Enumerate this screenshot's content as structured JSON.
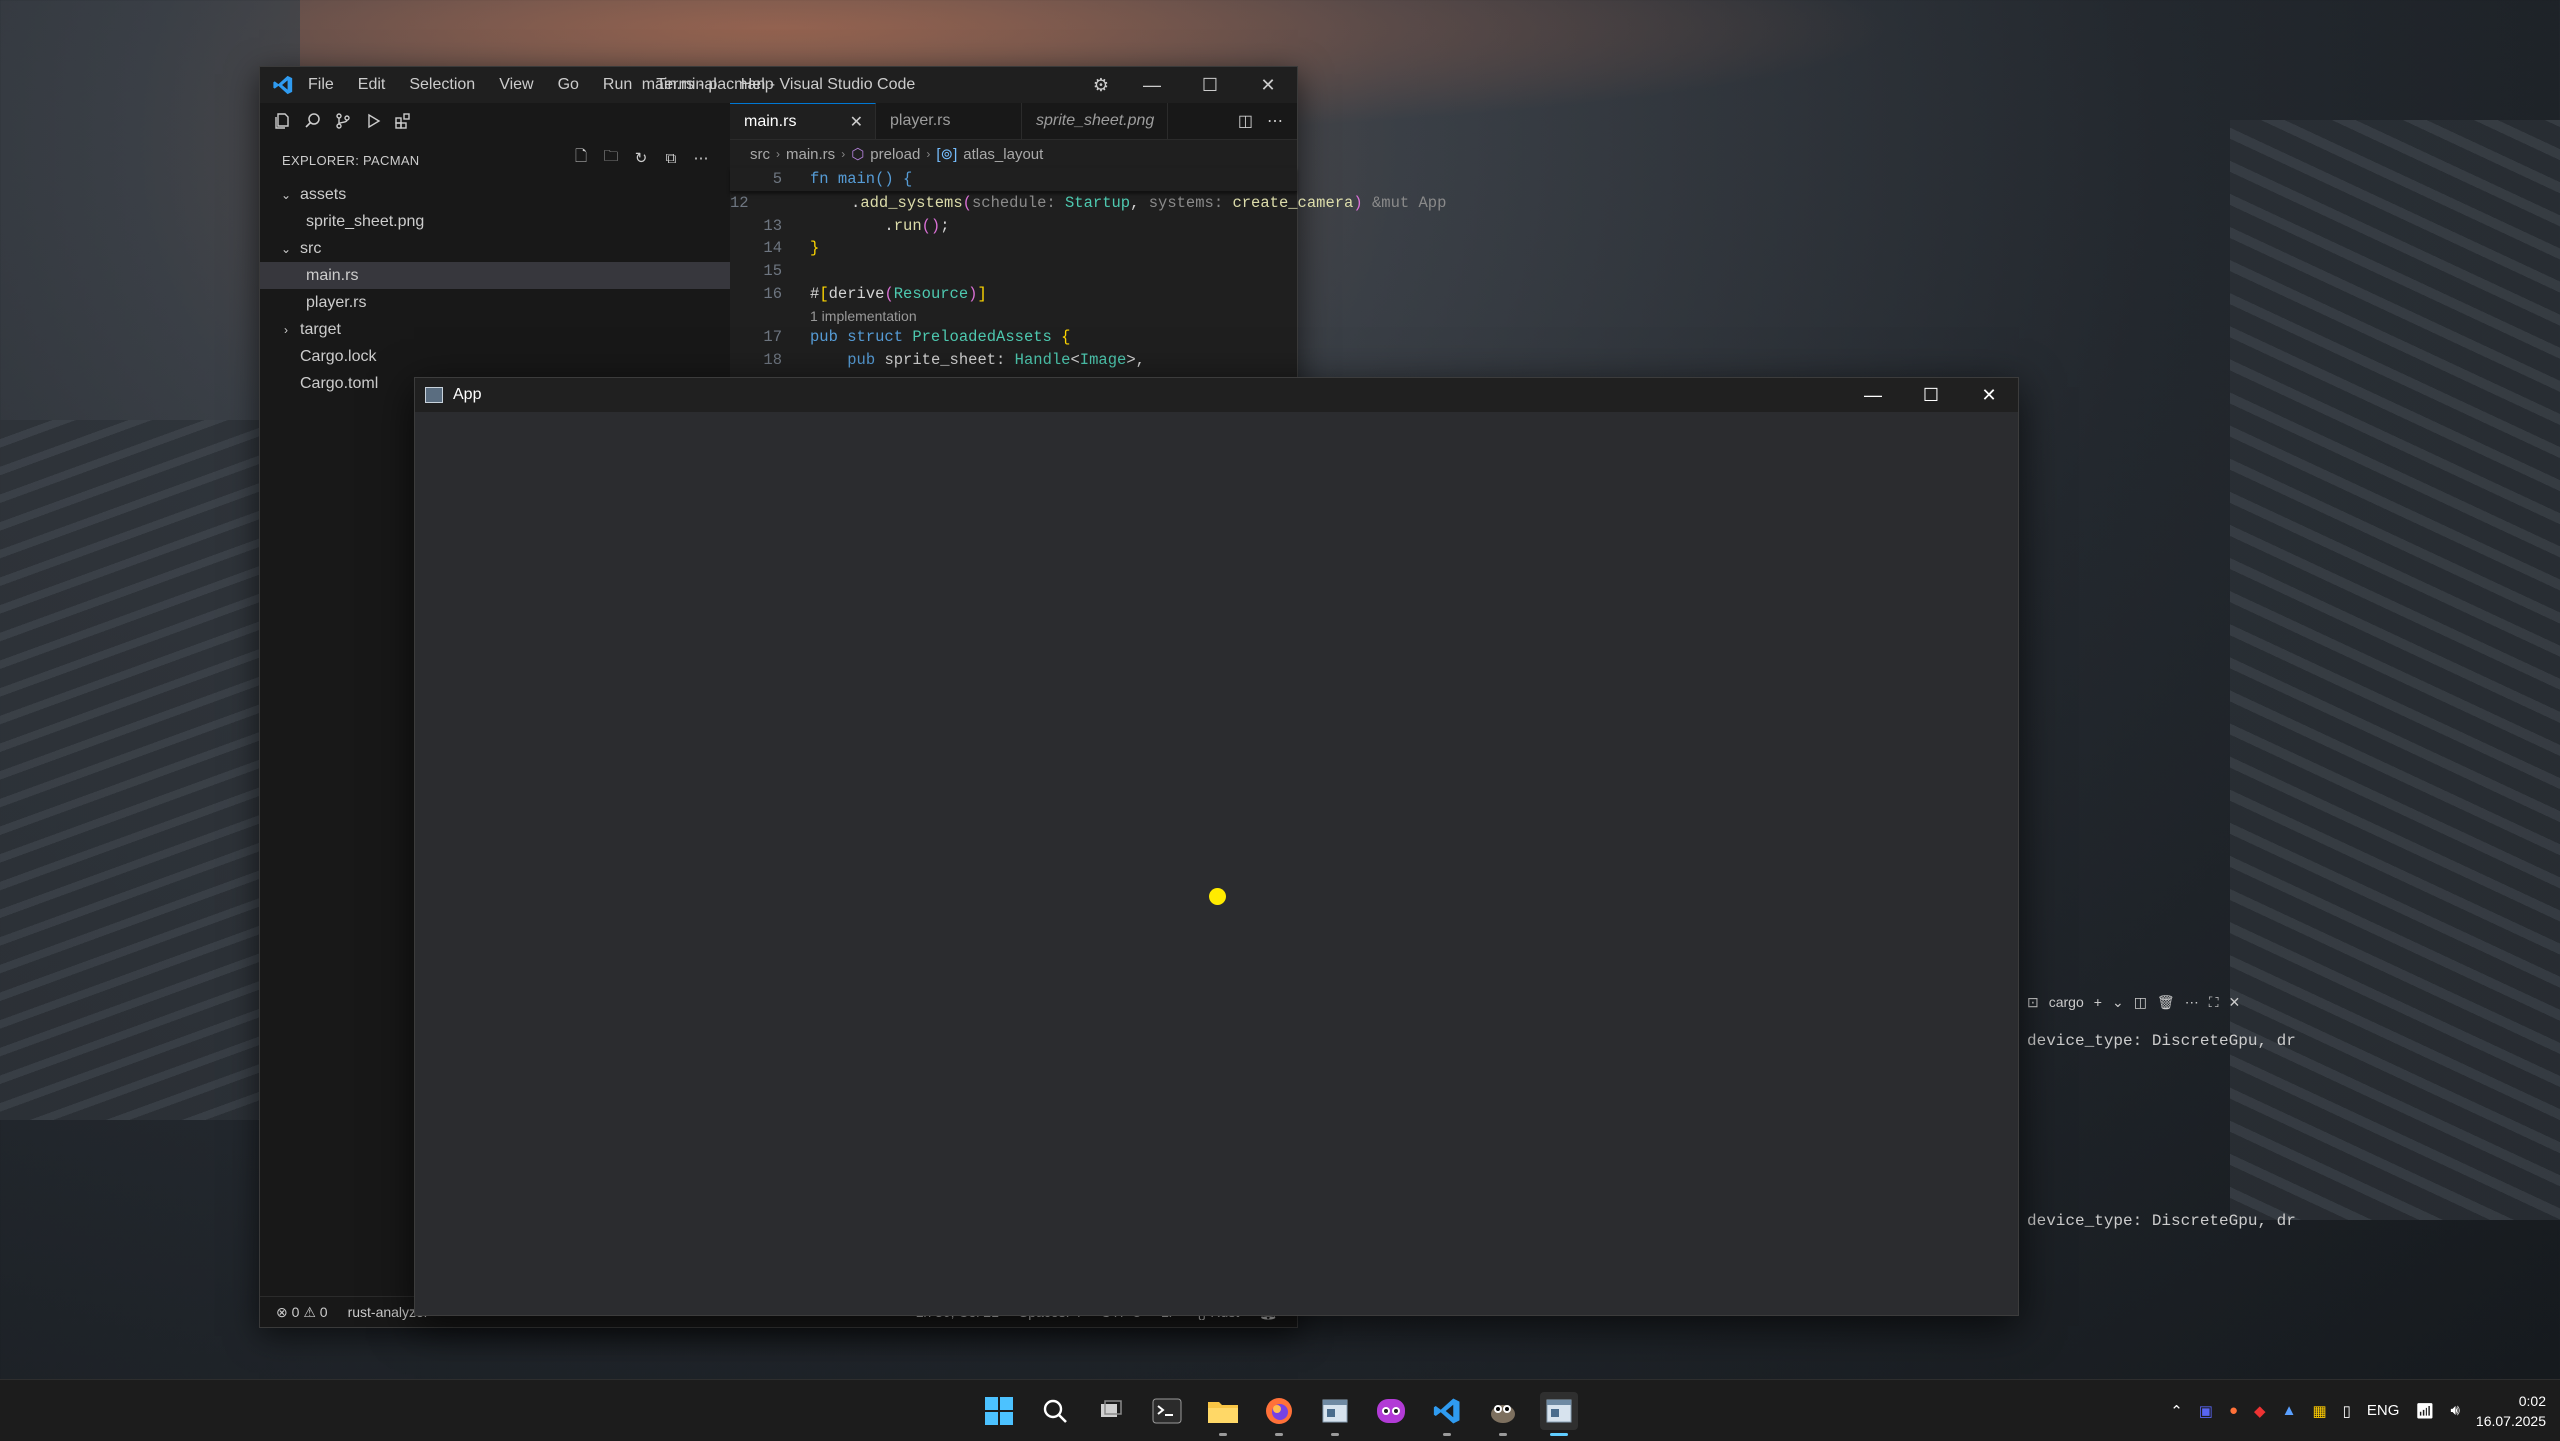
{
  "vscode": {
    "window_title": "main.rs - pacman - Visual Studio Code",
    "menu": [
      "File",
      "Edit",
      "Selection",
      "View",
      "Go",
      "Run",
      "Terminal",
      "Help"
    ],
    "explorer_title": "EXPLORER: PACMAN",
    "tree": [
      {
        "label": "assets",
        "type": "folder",
        "expanded": true,
        "depth": 0
      },
      {
        "label": "sprite_sheet.png",
        "type": "file",
        "depth": 1
      },
      {
        "label": "src",
        "type": "folder",
        "expanded": true,
        "depth": 0
      },
      {
        "label": "main.rs",
        "type": "file",
        "depth": 1,
        "selected": true
      },
      {
        "label": "player.rs",
        "type": "file",
        "depth": 1
      },
      {
        "label": "target",
        "type": "folder",
        "expanded": false,
        "depth": 0
      },
      {
        "label": "Cargo.lock",
        "type": "file",
        "depth": 0
      },
      {
        "label": "Cargo.toml",
        "type": "file",
        "depth": 0
      }
    ],
    "tabs": [
      {
        "label": "main.rs",
        "active": true
      },
      {
        "label": "player.rs",
        "active": false
      },
      {
        "label": "sprite_sheet.png",
        "active": false,
        "italic": true
      }
    ],
    "breadcrumb": [
      "src",
      "main.rs",
      "preload",
      "atlas_layout"
    ],
    "code": {
      "sticky_line": {
        "num": "5",
        "text": "fn main() {"
      },
      "lines": [
        {
          "num": "12",
          "segments": [
            [
              "pn",
              "        ."
            ],
            [
              "fn",
              "add_systems"
            ],
            [
              "br2",
              "("
            ],
            [
              "hint",
              "schedule: "
            ],
            [
              "ty",
              "Startup"
            ],
            [
              "pn",
              ", "
            ],
            [
              "hint",
              "systems: "
            ],
            [
              "fn",
              "create_camera"
            ],
            [
              "br2",
              ")"
            ],
            [
              "hint",
              " &mut App"
            ]
          ]
        },
        {
          "num": "13",
          "segments": [
            [
              "pn",
              "        ."
            ],
            [
              "fn",
              "run"
            ],
            [
              "br2",
              "()"
            ],
            [
              "pn",
              ";"
            ]
          ]
        },
        {
          "num": "14",
          "segments": [
            [
              "br",
              "}"
            ]
          ]
        },
        {
          "num": "15",
          "segments": []
        },
        {
          "num": "16",
          "segments": [
            [
              "pn",
              "#"
            ],
            [
              "br",
              "["
            ],
            [
              "attr",
              "derive"
            ],
            [
              "br2",
              "("
            ],
            [
              "ty",
              "Resource"
            ],
            [
              "br2",
              ")"
            ],
            [
              "br",
              "]"
            ]
          ]
        },
        {
          "codelens": "1 implementation"
        },
        {
          "num": "17",
          "segments": [
            [
              "kw",
              "pub struct "
            ],
            [
              "ty",
              "PreloadedAssets"
            ],
            [
              "pn",
              " "
            ],
            [
              "br",
              "{"
            ]
          ]
        },
        {
          "num": "18",
          "segments": [
            [
              "pn",
              "    "
            ],
            [
              "kw",
              "pub "
            ],
            [
              "pn",
              "sprite_sheet: "
            ],
            [
              "ty",
              "Handle"
            ],
            [
              "pn",
              "<"
            ],
            [
              "ty",
              "Image"
            ],
            [
              "pn",
              ">,"
            ]
          ]
        }
      ]
    },
    "terminal": {
      "tab_label": "cargo",
      "lines": [
        "device_type: DiscreteGpu, dr",
        "device_type: DiscreteGpu, dr"
      ]
    },
    "status": {
      "errors": "0",
      "warnings": "0",
      "language_server": "rust-analyzer",
      "cursor": "Ln 30, Col 21",
      "indent": "Spaces: 4",
      "encoding": "UTF-8",
      "eol": "LF",
      "language": "Rust"
    }
  },
  "app": {
    "title": "App",
    "dot_color": "#ffeb00"
  },
  "taskbar": {
    "apps": [
      "windows-start",
      "search",
      "task-view",
      "terminal",
      "file-explorer",
      "firefox",
      "app-window",
      "discord-style-app",
      "vscode",
      "gimp",
      "app-window-active"
    ],
    "language": "ENG",
    "time": "0:02",
    "date": "16.07.2025"
  }
}
